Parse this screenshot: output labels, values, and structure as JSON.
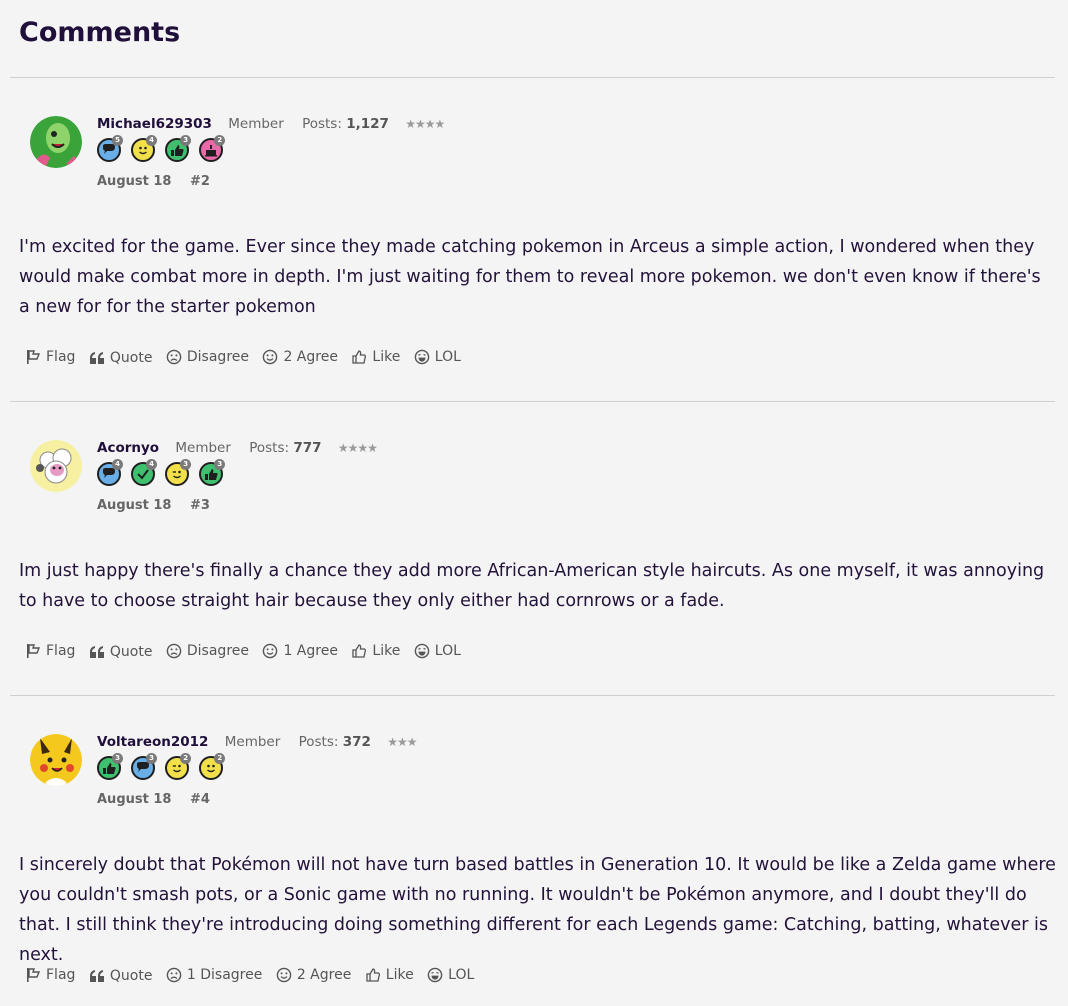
{
  "heading": "Comments",
  "comments": [
    {
      "username": "Michael629303",
      "role": "Member",
      "posts_label": "Posts:",
      "posts_count": "1,127",
      "stars": "★★★★",
      "avatar_colors": {
        "bg": "#3aa43a",
        "accent": "#e25a8c"
      },
      "badges": [
        {
          "icon": "speech-bubble-icon",
          "count": "5",
          "color": "#6aaee8"
        },
        {
          "icon": "smiley-icon",
          "count": "4",
          "color": "#f2e04a"
        },
        {
          "icon": "thumbs-up-icon",
          "count": "3",
          "color": "#3ec06e"
        },
        {
          "icon": "cake-icon",
          "count": "2",
          "color": "#e86aa8"
        }
      ],
      "date": "August 18",
      "number": "#2",
      "text": "I'm excited for the game. Ever since they made catching pokemon in Arceus a simple action, I wondered when they would make combat more in depth. I'm just waiting for them to reveal more pokemon. we don't even know if there's a new for for the starter pokemon",
      "actions": {
        "flag": "Flag",
        "quote": "Quote",
        "disagree": "Disagree",
        "agree": "2 Agree",
        "like": "Like",
        "lol": "LOL"
      }
    },
    {
      "username": "Acornyo",
      "role": "Member",
      "posts_label": "Posts:",
      "posts_count": "777",
      "stars": "★★★★",
      "avatar_colors": {
        "bg": "#f6f0a0",
        "accent": "#e59ac4"
      },
      "badges": [
        {
          "icon": "speech-bubble-icon",
          "count": "4",
          "color": "#6aaee8"
        },
        {
          "icon": "checkmark-icon",
          "count": "4",
          "color": "#3ec06e"
        },
        {
          "icon": "wink-smiley-icon",
          "count": "3",
          "color": "#f2e04a"
        },
        {
          "icon": "thumbs-up-icon",
          "count": "3",
          "color": "#3ec06e"
        }
      ],
      "date": "August 18",
      "number": "#3",
      "text": "Im just happy there's finally a chance they add more African-American style haircuts. As one myself, it was annoying to have to choose straight hair because they only either had cornrows or a fade.",
      "actions": {
        "flag": "Flag",
        "quote": "Quote",
        "disagree": "Disagree",
        "agree": "1 Agree",
        "like": "Like",
        "lol": "LOL"
      }
    },
    {
      "username": "Voltareon2012",
      "role": "Member",
      "posts_label": "Posts:",
      "posts_count": "372",
      "stars": "★★★",
      "avatar_colors": {
        "bg": "#f5c81e",
        "accent": "#e04a2a"
      },
      "badges": [
        {
          "icon": "thumbs-up-icon",
          "count": "3",
          "color": "#3ec06e"
        },
        {
          "icon": "speech-bubble-icon",
          "count": "3",
          "color": "#6aaee8"
        },
        {
          "icon": "wink-smiley-icon",
          "count": "2",
          "color": "#f2e04a"
        },
        {
          "icon": "smiley-icon",
          "count": "2",
          "color": "#f2e04a"
        }
      ],
      "date": "August 18",
      "number": "#4",
      "text": "I sincerely doubt that Pokémon will not have turn based battles in Generation 10. It would be like a Zelda game where you couldn't smash pots, or a Sonic game with no running. It wouldn't be Pokémon anymore, and I doubt they'll do that. I still think they're introducing doing something different for each Legends game: Catching, batting, whatever is next.",
      "actions": {
        "flag": "Flag",
        "quote": "Quote",
        "disagree": "1 Disagree",
        "agree": "2 Agree",
        "like": "Like",
        "lol": "LOL"
      }
    }
  ]
}
